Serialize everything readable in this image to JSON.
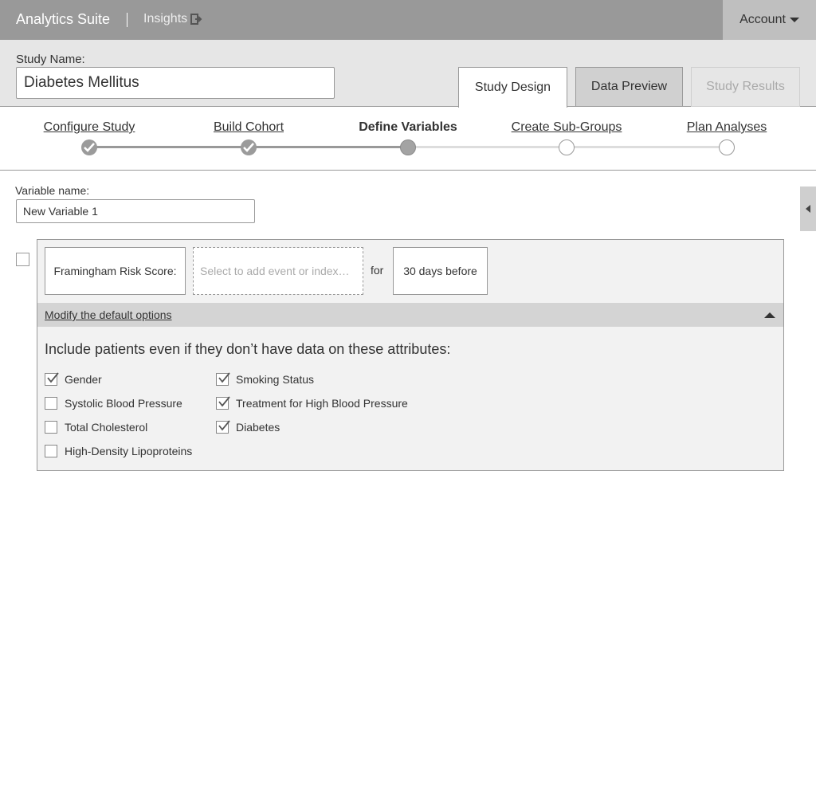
{
  "app": {
    "title": "Analytics Suite",
    "section_link": "Insights",
    "account_label": "Account"
  },
  "study": {
    "label": "Study Name:",
    "name_value": "Diabetes Mellitus"
  },
  "tabs": [
    {
      "label": "Study Design",
      "state": "active"
    },
    {
      "label": "Data Preview",
      "state": "enabled"
    },
    {
      "label": "Study Results",
      "state": "disabled"
    }
  ],
  "steps": [
    {
      "label": "Configure Study",
      "status": "complete"
    },
    {
      "label": "Build Cohort",
      "status": "complete"
    },
    {
      "label": "Define Variables",
      "status": "current"
    },
    {
      "label": "Create Sub-Groups",
      "status": "todo"
    },
    {
      "label": "Plan Analyses",
      "status": "todo"
    }
  ],
  "variable": {
    "label": "Variable name:",
    "name_value": "New Variable 1",
    "score_label": "Framingham Risk Score:",
    "event_placeholder": "Select to add event or index…",
    "for_text": "for",
    "time_window": "30 days before",
    "options_link": "Modify the default options",
    "include_title": "Include patients even if they don’t have data on these attributes:",
    "attributes_left": [
      {
        "label": "Gender",
        "checked": true
      },
      {
        "label": "Systolic Blood Pressure",
        "checked": false
      },
      {
        "label": "Total Cholesterol",
        "checked": false
      },
      {
        "label": "High-Density Lipoproteins",
        "checked": false
      }
    ],
    "attributes_right": [
      {
        "label": "Smoking Status",
        "checked": true
      },
      {
        "label": "Treatment for High Blood Pressure",
        "checked": true
      },
      {
        "label": "Diabetes",
        "checked": true
      }
    ]
  },
  "colors": {
    "topbar": "#999999",
    "header_bg": "#e6e6e6",
    "account_bg": "#bfbfbf",
    "panel_bg": "#f2f2f2",
    "options_bar": "#d4d4d4"
  },
  "icons": {
    "insights": "exit-arrow-icon",
    "account": "caret-down-icon",
    "collapse": "caret-left-icon",
    "options_toggle": "caret-up-icon",
    "checkmark": "check-icon"
  }
}
